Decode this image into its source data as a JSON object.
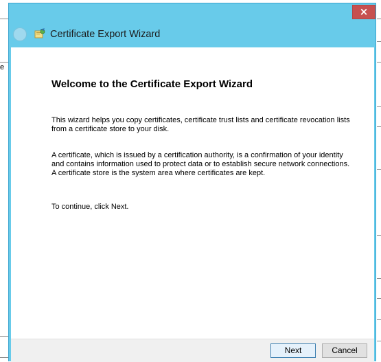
{
  "window": {
    "title": "Certificate Export Wizard",
    "close_glyph": "×",
    "back_icon": "back-arrow-icon",
    "app_icon": "certificate-icon"
  },
  "background": {
    "left_glyph": "e"
  },
  "main": {
    "heading": "Welcome to the Certificate Export Wizard",
    "paragraphs": {
      "intro": "This wizard helps you copy certificates, certificate trust lists and certificate revocation lists from a certificate store to your disk.",
      "definition": "A certificate, which is issued by a certification authority, is a confirmation of your identity and contains information used to protect data or to establish secure network connections. A certificate store is the system area where certificates are kept.",
      "continue": "To continue, click Next."
    }
  },
  "footer": {
    "next_label": "Next",
    "cancel_label": "Cancel"
  },
  "colors": {
    "title_bar": "#68cbea",
    "close_button": "#c75050",
    "next_border": "#3c7fb1"
  }
}
